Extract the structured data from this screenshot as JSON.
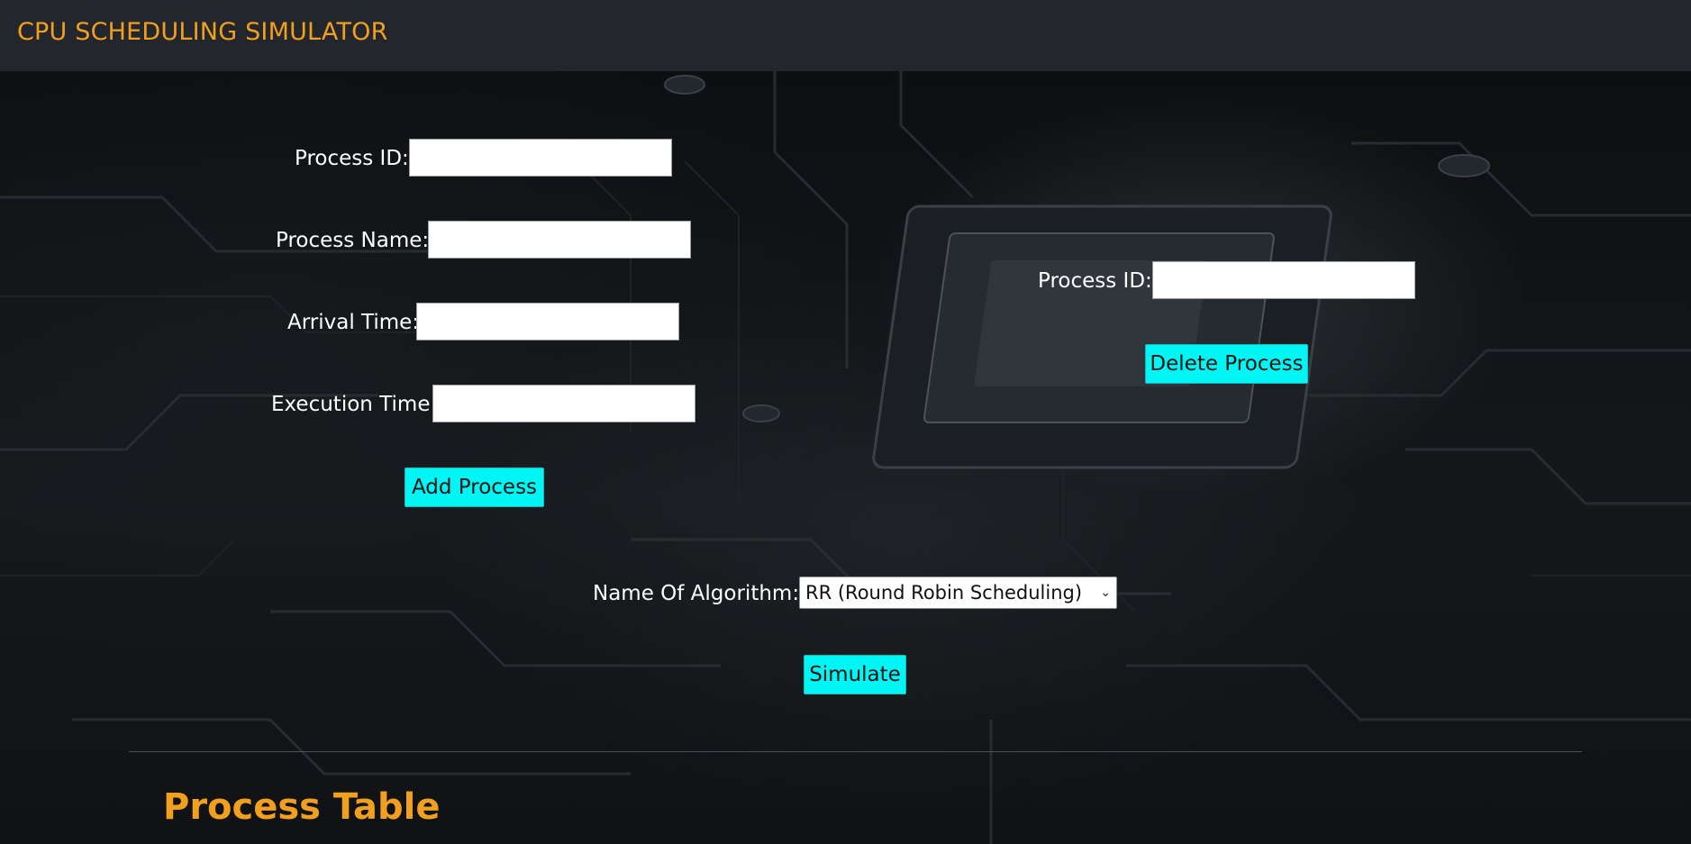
{
  "header": {
    "title": "CPU SCHEDULING SIMULATOR"
  },
  "add_form": {
    "process_id_label": "Process ID:",
    "process_id_value": "",
    "process_name_label": "Process Name:",
    "process_name_value": "",
    "arrival_time_label": "Arrival Time:",
    "arrival_time_value": "",
    "execution_time_label": "Execution Time:",
    "execution_time_value": "",
    "add_button_label": "Add Process"
  },
  "delete_form": {
    "process_id_label": "Process ID:",
    "process_id_value": "",
    "delete_button_label": "Delete Process"
  },
  "algorithm": {
    "label": "Name Of Algorithm:",
    "selected": "RR (Round Robin Scheduling)",
    "chevron_icon": "chevron-down-icon"
  },
  "simulate": {
    "button_label": "Simulate"
  },
  "process_table": {
    "heading": "Process Table"
  },
  "colors": {
    "header_bg": "#23262c",
    "accent_orange": "#f0a01e",
    "button_cyan": "#00f5f5"
  }
}
